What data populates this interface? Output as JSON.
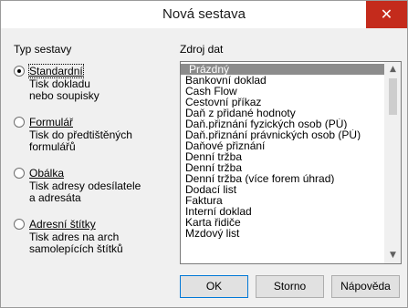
{
  "window": {
    "title": "Nová sestava",
    "close_glyph": "✕"
  },
  "left_group": {
    "label": "Typ sestavy",
    "options": [
      {
        "label": "Standardní",
        "description": "Tisk dokladu\nnebo soupisky",
        "checked": true
      },
      {
        "label": "Formulář",
        "description": "Tisk do předtištěných\nformulářů",
        "checked": false
      },
      {
        "label": "Obálka",
        "description": "Tisk adresy odesílatele\na adresáta",
        "checked": false
      },
      {
        "label": "Adresní štítky",
        "description": "Tisk adres na arch\nsamolepících štítků",
        "checked": false
      }
    ]
  },
  "right_group": {
    "label": "Zdroj dat",
    "items": [
      "Prázdný",
      "Bankovní doklad",
      "Cash Flow",
      "Cestovní příkaz",
      "Daň z přidané hodnoty",
      "Daň.přiznání fyzických osob (PÚ)",
      "Daň.přiznání právnických osob (PÚ)",
      "Daňové přiznání",
      "Denní tržba",
      "Denní tržba",
      "Denní tržba (více forem úhrad)",
      "Dodací list",
      "Faktura",
      "Interní doklad",
      "Karta řidiče",
      "Mzdový list"
    ],
    "selected_index": 0,
    "scroll_up_icon": "▲",
    "scroll_down_icon": "▼"
  },
  "buttons": {
    "ok": "OK",
    "cancel": "Storno",
    "help": "Nápověda"
  },
  "colors": {
    "close_bg": "#c42b1c",
    "selected_bg": "#8c8c8c",
    "dialog_bg": "#f0f0f0"
  }
}
